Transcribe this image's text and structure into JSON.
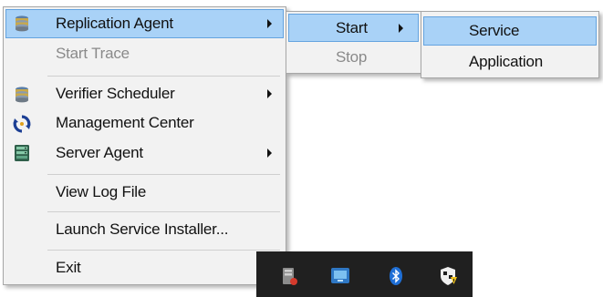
{
  "main_menu": {
    "items": [
      {
        "label": "Replication Agent",
        "icon": "database-icon",
        "submenu": true,
        "highlighted": true
      },
      {
        "label": "Start Trace",
        "disabled": true
      },
      {
        "label": "Verifier Scheduler",
        "icon": "database-icon",
        "submenu": true
      },
      {
        "label": "Management Center",
        "icon": "sync-icon"
      },
      {
        "label": "Server Agent",
        "icon": "server-icon",
        "submenu": true
      },
      {
        "label": "View Log File"
      },
      {
        "label": "Launch Service Installer..."
      },
      {
        "label": "Exit"
      }
    ]
  },
  "start_menu": {
    "items": [
      {
        "label": "Start",
        "submenu": true,
        "highlighted": true
      },
      {
        "label": "Stop",
        "disabled": true
      }
    ]
  },
  "service_menu": {
    "items": [
      {
        "label": "Service",
        "highlighted": true
      },
      {
        "label": "Application"
      }
    ]
  },
  "taskbar": {
    "icons": [
      "server-tray-icon",
      "network-tray-icon",
      "bluetooth-icon",
      "security-shield-icon"
    ]
  },
  "colors": {
    "menu_background": "#f2f2f2",
    "highlight_fill": "#a9d2f7",
    "highlight_border": "#64a3df",
    "disabled_text": "#8a8a8a",
    "taskbar": "#202020"
  }
}
